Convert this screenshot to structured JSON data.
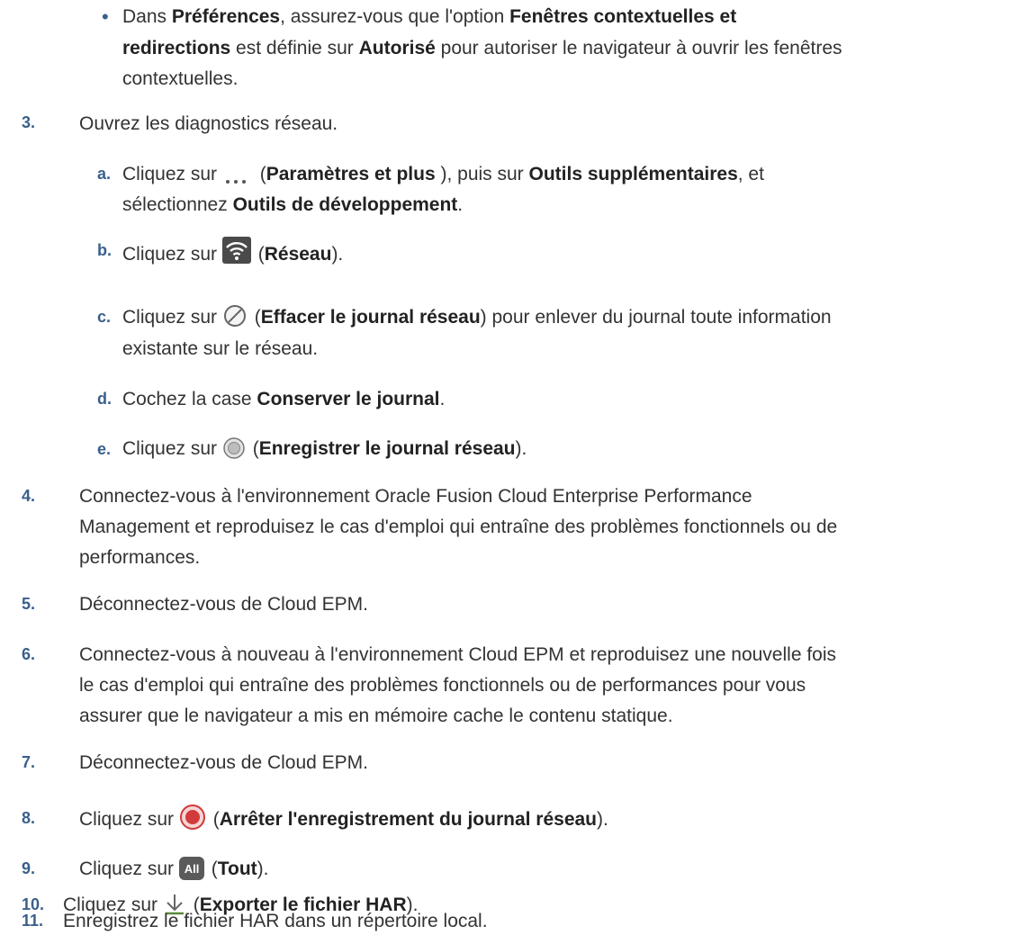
{
  "bullet_item": {
    "marker": "•",
    "parts": [
      "Dans ",
      "Préférences",
      ", assurez-vous que l'option ",
      "Fenêtres contextuelles et",
      "redirections",
      " est définie sur ",
      "Autorisé",
      " pour autoriser le navigateur à ouvrir les fenêtres",
      "contextuelles."
    ]
  },
  "steps": {
    "s3": {
      "num": "3.",
      "text": "Ouvrez les diagnostics réseau."
    },
    "s3a": {
      "marker": "a.",
      "p1": "Cliquez sur ",
      "p2": " (",
      "b1": "Paramètres et plus ",
      "p3": "), puis sur ",
      "b2": "Outils supplémentaires",
      "p4": ", et",
      "p5": "sélectionnez ",
      "b3": "Outils de développement",
      "p6": "."
    },
    "s3b": {
      "marker": "b.",
      "p1": "Cliquez sur ",
      "p2": " (",
      "b1": "Réseau",
      "p3": ")."
    },
    "s3c": {
      "marker": "c.",
      "p1": "Cliquez sur ",
      "p2": " (",
      "b1": "Effacer le journal réseau",
      "p3": ") pour enlever du journal toute information",
      "p4": "existante sur le réseau."
    },
    "s3d": {
      "marker": "d.",
      "p1": "Cochez la case ",
      "b1": "Conserver le journal",
      "p2": "."
    },
    "s3e": {
      "marker": "e.",
      "p1": "Cliquez sur ",
      "p2": " (",
      "b1": "Enregistrer le journal réseau",
      "p3": ")."
    },
    "s4": {
      "num": "4.",
      "l1": "Connectez-vous à l'environnement Oracle Fusion Cloud Enterprise Performance",
      "l2": "Management et reproduisez le cas d'emploi qui entraîne des problèmes fonctionnels ou de",
      "l3": "performances."
    },
    "s5": {
      "num": "5.",
      "text": "Déconnectez-vous de Cloud EPM."
    },
    "s6": {
      "num": "6.",
      "l1": "Connectez-vous à nouveau à l'environnement Cloud EPM et reproduisez une nouvelle fois",
      "l2": "le cas d'emploi qui entraîne des problèmes fonctionnels ou de performances pour vous",
      "l3": "assurer que le navigateur a mis en mémoire cache le contenu statique."
    },
    "s7": {
      "num": "7.",
      "text": "Déconnectez-vous de Cloud EPM."
    },
    "s8": {
      "num": "8.",
      "p1": "Cliquez sur ",
      "p2": " (",
      "b1": "Arrêter l'enregistrement du journal réseau",
      "p3": ")."
    },
    "s9": {
      "num": "9.",
      "p1": "Cliquez sur ",
      "p2": " (",
      "b1": "Tout",
      "p3": ")."
    },
    "s10": {
      "num": "10.",
      "p1": "Cliquez sur ",
      "p2": " (",
      "b1": "Exporter le fichier HAR",
      "p3": ")."
    },
    "s11": {
      "num": "11.",
      "text": "Enregistrez le fichier HAR dans un répertoire local."
    }
  },
  "icons": {
    "all_icon_label": "All"
  }
}
